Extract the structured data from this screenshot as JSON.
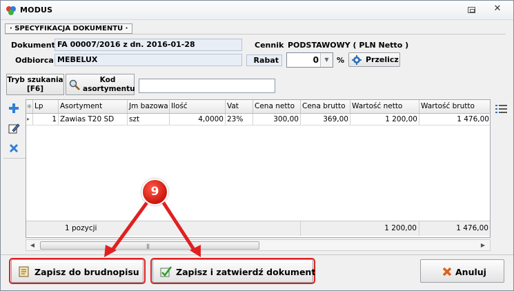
{
  "window": {
    "title": "MODUS"
  },
  "section": {
    "label": "· SPECYFIKACJA DOKUMENTU ·"
  },
  "header": {
    "dokument_label": "Dokument",
    "dokument_value": "FA 00007/2016 z dn. 2016-01-28",
    "odbiorca_label": "Odbiorca",
    "odbiorca_value": "MEBELUX",
    "cennik_label": "Cennik",
    "cennik_value": "PODSTAWOWY ( PLN Netto )",
    "rabat_label": "Rabat",
    "rabat_value": "0",
    "rabat_unit": "%",
    "przelicz_label": "Przelicz"
  },
  "search": {
    "tryb_label_line1": "Tryb szukania",
    "tryb_label_line2": "[F6]",
    "kod_label_line1": "Kod",
    "kod_label_line2": "asortymentu",
    "value": ""
  },
  "grid": {
    "columns": [
      "Lp",
      "Asortyment",
      "Jm bazowa",
      "Ilość",
      "Vat",
      "Cena netto",
      "Cena brutto",
      "Wartość netto",
      "Wartość brutto"
    ],
    "rows": [
      {
        "lp": "1",
        "asortyment": "Zawias T20 SD",
        "jm": "szt",
        "ilosc": "4,0000",
        "vat": "23%",
        "cena_netto": "300,00",
        "cena_brutto": "369,00",
        "wartosc_netto": "1 200,00",
        "wartosc_brutto": "1 476,00"
      }
    ],
    "footer": {
      "count": "1 pozycji",
      "wartosc_netto": "1 200,00",
      "wartosc_brutto": "1 476,00"
    }
  },
  "buttons": {
    "zapisz_brudnopis": "Zapisz do brudnopisu",
    "zapisz_zatwierdz": "Zapisz i zatwierdź dokument",
    "anuluj": "Anuluj"
  },
  "annotation": {
    "marker": "9",
    "color": "#e02020"
  }
}
